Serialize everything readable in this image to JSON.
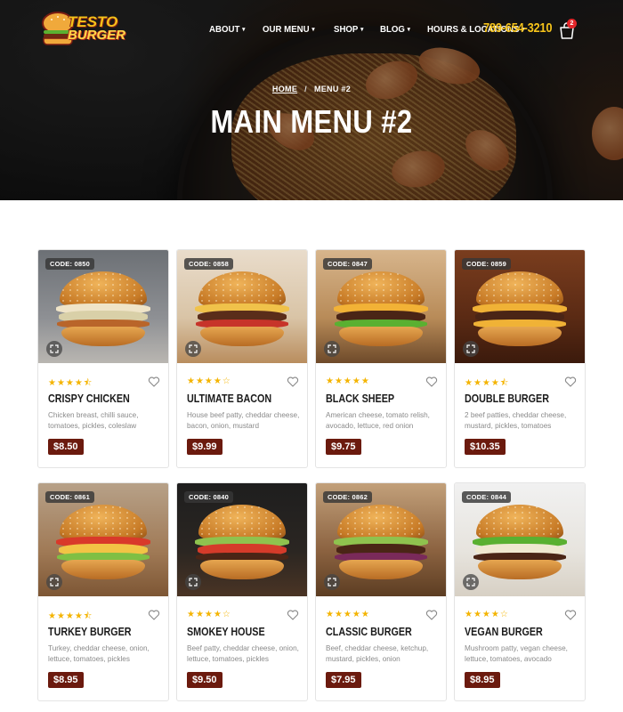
{
  "header": {
    "logo_line1": "TESTO",
    "logo_line2": "BURGER",
    "nav": [
      {
        "label": "ABOUT"
      },
      {
        "label": "OUR MENU"
      },
      {
        "label": "SHOP"
      },
      {
        "label": "BLOG"
      },
      {
        "label": "HOURS & LOCATIONS"
      }
    ],
    "phone": "789-654-3210",
    "cart_count": "2"
  },
  "hero": {
    "breadcrumb_home": "HOME",
    "breadcrumb_sep": "/",
    "breadcrumb_current": "MENU #2",
    "title": "MAIN MENU #2"
  },
  "colors": {
    "accent_yellow": "#f4c21a",
    "price_bg": "#6b1a0e",
    "star": "#f4b400",
    "badge_red": "#e3262a"
  },
  "menu": [
    {
      "code": "CODE: 0850",
      "rating": 4.5,
      "name": "CRISPY CHICKEN",
      "desc": "Chicken breast, chilli sauce, tomatoes, pickles, coleslaw",
      "price": "$8.50"
    },
    {
      "code": "CODE: 0858",
      "rating": 4,
      "name": "ULTIMATE BACON",
      "desc": "House beef patty, cheddar cheese, bacon, onion, mustard",
      "price": "$9.99"
    },
    {
      "code": "CODE: 0847",
      "rating": 5,
      "name": "BLACK SHEEP",
      "desc": "American cheese, tomato relish, avocado, lettuce, red onion",
      "price": "$9.75"
    },
    {
      "code": "CODE: 0859",
      "rating": 4.5,
      "name": "DOUBLE BURGER",
      "desc": "2 beef patties, cheddar cheese, mustard, pickles, tomatoes",
      "price": "$10.35"
    },
    {
      "code": "CODE: 0861",
      "rating": 4.5,
      "name": "TURKEY BURGER",
      "desc": "Turkey, cheddar cheese, onion, lettuce, tomatoes, pickles",
      "price": "$8.95"
    },
    {
      "code": "CODE: 0840",
      "rating": 4,
      "name": "SMOKEY HOUSE",
      "desc": "Beef patty, cheddar cheese, onion, lettuce, tomatoes, pickles",
      "price": "$9.50"
    },
    {
      "code": "CODE: 0862",
      "rating": 5,
      "name": "CLASSIC BURGER",
      "desc": "Beef, cheddar cheese, ketchup, mustard, pickles, onion",
      "price": "$7.95"
    },
    {
      "code": "CODE: 0844",
      "rating": 4,
      "name": "VEGAN BURGER",
      "desc": "Mushroom patty, vegan cheese, lettuce, tomatoes, avocado",
      "price": "$8.95"
    }
  ]
}
